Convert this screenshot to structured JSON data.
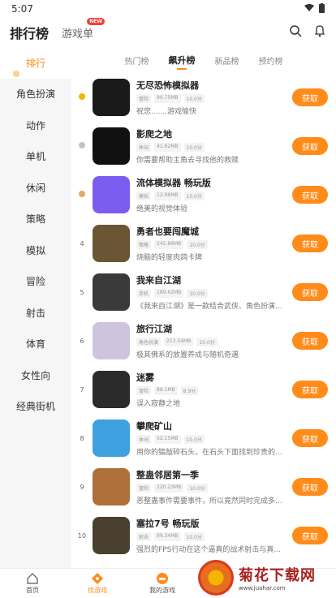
{
  "status": {
    "time": "5:07"
  },
  "header": {
    "title": "排行榜",
    "tab2": "游戏单",
    "badge": "NEW"
  },
  "sidebar": {
    "items": [
      {
        "label": "排行",
        "active": true
      },
      {
        "label": "角色扮演"
      },
      {
        "label": "动作"
      },
      {
        "label": "单机"
      },
      {
        "label": "休闲"
      },
      {
        "label": "策略"
      },
      {
        "label": "模拟"
      },
      {
        "label": "冒险"
      },
      {
        "label": "射击"
      },
      {
        "label": "体育"
      },
      {
        "label": "女性向"
      },
      {
        "label": "经典街机"
      }
    ]
  },
  "subtabs": [
    "热门榜",
    "飙升榜",
    "新品榜",
    "预约榜"
  ],
  "games": [
    {
      "rank": "1",
      "medal": "#f5b400",
      "title": "无尽恐怖模拟器",
      "tags": [
        "冒险",
        "90.75MB",
        "10.0分"
      ],
      "desc": "祝您.......游戏愉快",
      "icon": "#1a1a1a"
    },
    {
      "rank": "2",
      "medal": "#b9c4d0",
      "title": "影爬之地",
      "tags": [
        "休闲",
        "41.62MB",
        "10.0分"
      ],
      "desc": "你需要帮助主角去寻找他的救赎",
      "icon": "#111111"
    },
    {
      "rank": "3",
      "medal": "#e6a56b",
      "title": "流体模拟器 畅玩版",
      "tags": [
        "模拟",
        "12.96MB",
        "10.0分"
      ],
      "desc": "绝美的视觉体验",
      "icon": "#7d5cf2"
    },
    {
      "rank": "4",
      "title": "勇者也要闯魔城",
      "tags": [
        "策略",
        "245.86MB",
        "10.0分"
      ],
      "desc": "烧脑的轻度肉鸽卡牌",
      "icon": "#6a5634"
    },
    {
      "rank": "5",
      "title": "我来自江湖",
      "tags": [
        "单机",
        "189.62MB",
        "10.0分"
      ],
      "desc": "《我来自江湖》是一款结合武侠、角色扮演...",
      "icon": "#3a3a3a"
    },
    {
      "rank": "6",
      "title": "旅行江湖",
      "tags": [
        "角色扮演",
        "213.54MB",
        "10.0分"
      ],
      "desc": "极其佛系的放置养成与随机奇遇",
      "icon": "#cfc4e0"
    },
    {
      "rank": "7",
      "title": "迷雾",
      "tags": [
        "冒险",
        "88.1MB",
        "8.9分"
      ],
      "desc": "误入寂静之地",
      "icon": "#2b2b2b"
    },
    {
      "rank": "8",
      "title": "攀爬矿山",
      "tags": [
        "休闲",
        "52.15MB",
        "10.0分"
      ],
      "desc": "用你的镐敲碎石头，在石头下面找到珍贵的...",
      "icon": "#3fa0e0"
    },
    {
      "rank": "9",
      "title": "整蛊邻居第一季",
      "tags": [
        "冒险",
        "220.23MB",
        "10.0分"
      ],
      "desc": "恶整蛊事件需要事件，所以竟然同时完成多...",
      "icon": "#b0703a"
    },
    {
      "rank": "10",
      "title": "塞拉7号 畅玩版",
      "tags": [
        "射击",
        "99.34MB",
        "10.0分"
      ],
      "desc": "强烈的FPS行动在这个逼真的战术射击与真...",
      "icon": "#4a4030"
    }
  ],
  "get_label": "获取",
  "bottom_nav": [
    {
      "label": "首页"
    },
    {
      "label": "找游戏",
      "active": true
    },
    {
      "label": "我的游戏"
    }
  ],
  "watermark": {
    "main": "菊花下载网",
    "url": "www.juahar.com"
  }
}
